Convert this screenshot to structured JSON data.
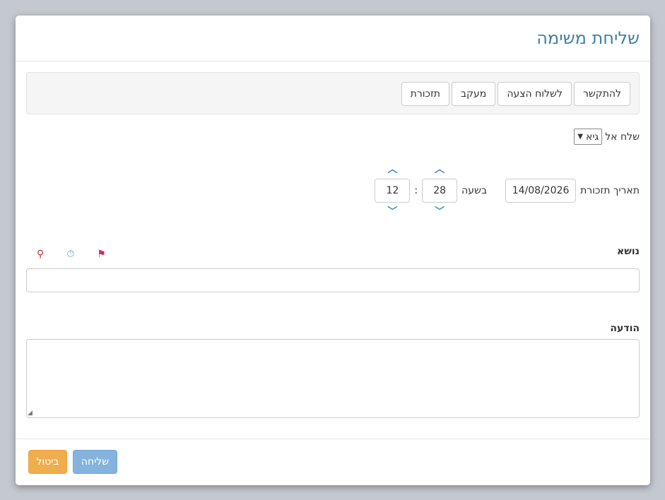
{
  "modal": {
    "title": "שליחת משימה"
  },
  "toolbar": {
    "buttons": [
      "להתקשר",
      "לשלוח הצעה",
      "מעקב",
      "תזכורת"
    ]
  },
  "send_to": {
    "label": "שלח אל",
    "selected": "גיא"
  },
  "reminder": {
    "date_label": "תאריך תזכורת",
    "date_value": "14/08/2026",
    "time_label": "בשעה",
    "minutes": "28",
    "hours": "12",
    "separator": ":"
  },
  "subject": {
    "label": "נושא",
    "value": ""
  },
  "message": {
    "label": "הודעה",
    "value": ""
  },
  "footer": {
    "send_label": "שליחה",
    "cancel_label": "ביטול"
  },
  "colors": {
    "title": "#3e7fa6",
    "send": "#84b3de",
    "cancel": "#f0ad4e",
    "spinner": "#428bca"
  },
  "icons": [
    "pin-icon",
    "timer-icon",
    "flag-icon",
    "chevron-up-icon",
    "chevron-down-icon"
  ]
}
